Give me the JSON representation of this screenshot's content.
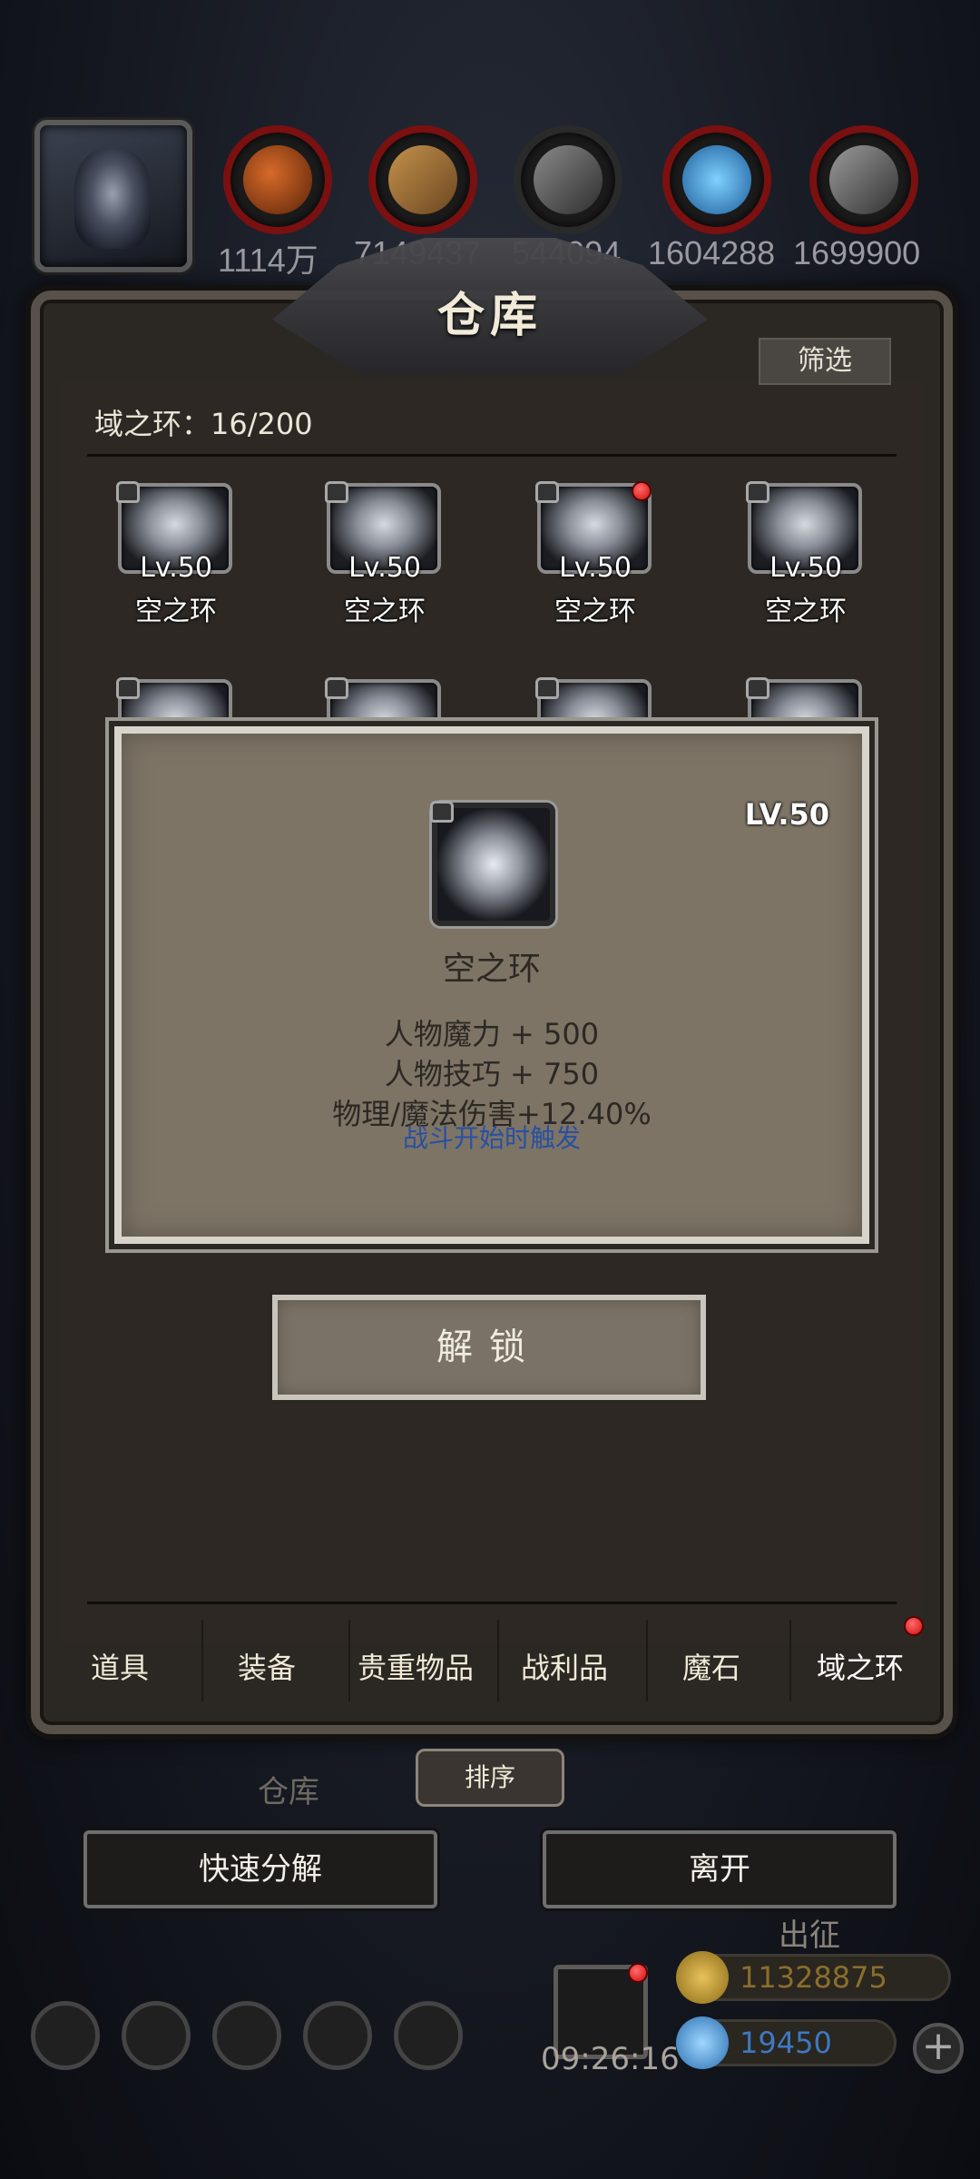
{
  "resources": [
    "1114万",
    "7149437",
    "544094",
    "1604288",
    "1699900"
  ],
  "panel": {
    "title": "仓库",
    "filter_label": "筛选",
    "count_label": "域之环：16/200"
  },
  "items": [
    {
      "lv": "Lv.50",
      "name": "空之环"
    },
    {
      "lv": "Lv.50",
      "name": "空之环"
    },
    {
      "lv": "Lv.50",
      "name": "空之环"
    },
    {
      "lv": "Lv.50",
      "name": "空之环"
    }
  ],
  "detail": {
    "lv": "LV.50",
    "name": "空之环",
    "stats": [
      "人物魔力 + 500",
      "人物技巧 + 750",
      "物理/魔法伤害+12.40%"
    ],
    "trigger": "战斗开始时触发"
  },
  "unlock_label": "解锁",
  "tabs": [
    "道具",
    "装备",
    "贵重物品",
    "战利品",
    "魔石",
    "域之环"
  ],
  "sort_label": "排序",
  "quick_decompose_label": "快速分解",
  "leave_label": "离开",
  "background": {
    "warehouse_label": "仓库",
    "expedition_label": "出征",
    "gold": "11328875",
    "gems": "19450",
    "timer": "09:26:16"
  },
  "colors": {
    "badge_red": "#d10f0f",
    "trigger_blue": "#2850a0",
    "popup_bg": "#7d7466"
  }
}
